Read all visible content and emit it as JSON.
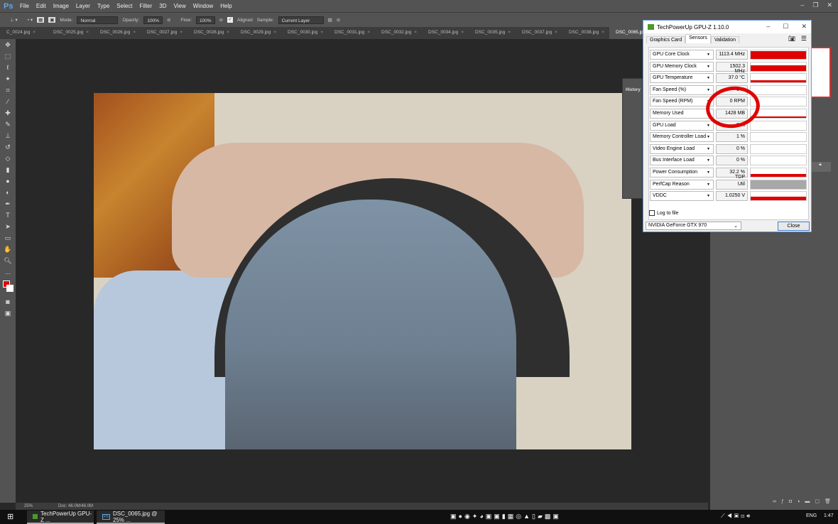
{
  "menubar": {
    "logo": "Ps",
    "items": [
      "File",
      "Edit",
      "Image",
      "Layer",
      "Type",
      "Select",
      "Filter",
      "3D",
      "View",
      "Window",
      "Help"
    ]
  },
  "options": {
    "mode_label": "Mode:",
    "mode": "Normal",
    "opacity_label": "Opacity:",
    "opacity": "100%",
    "flow_label": "Flow:",
    "flow": "100%",
    "aligned_label": "Aligned",
    "aligned": true,
    "sample_label": "Sample:",
    "sample": "Current Layer"
  },
  "tabs": [
    "C_0024.jpg",
    "DSC_0025.jpg",
    "DSC_0026.jpg",
    "DSC_0027.jpg",
    "DSC_0028.jpg",
    "DSC_0029.jpg",
    "DSC_0030.jpg",
    "DSC_0031.jpg",
    "DSC_0032.jpg",
    "DSC_0034.jpg",
    "DSC_0035.jpg",
    "DSC_0037.jpg",
    "DSC_0038.jpg",
    "DSC_0065.jpg"
  ],
  "active_tab": 13,
  "history": {
    "title": "History"
  },
  "status": {
    "zoom": "25%",
    "doc": "Doc: 46.0M/46.0M"
  },
  "gpuz": {
    "title": "TechPowerUp GPU-Z 1.10.0",
    "tabs": [
      "Graphics Card",
      "Sensors",
      "Validation"
    ],
    "active_tab": 1,
    "sensors": [
      {
        "label": "GPU Core Clock",
        "value": "1113.4 MHz",
        "graph": 0.9
      },
      {
        "label": "GPU Memory Clock",
        "value": "1502.3 MHz",
        "graph": 0.6
      },
      {
        "label": "GPU Temperature",
        "value": "37.0 °C",
        "graph": 0.25
      },
      {
        "label": "Fan Speed (%)",
        "value": "0 %",
        "graph": 0
      },
      {
        "label": "Fan Speed (RPM)",
        "value": "0 RPM",
        "graph": 0
      },
      {
        "label": "Memory Used",
        "value": "1428 MB",
        "graph": 0.2
      },
      {
        "label": "GPU Load",
        "value": "0 %",
        "graph": 0
      },
      {
        "label": "Memory Controller Load",
        "value": "1 %",
        "graph": 0
      },
      {
        "label": "Video Engine Load",
        "value": "0 %",
        "graph": 0
      },
      {
        "label": "Bus Interface Load",
        "value": "0 %",
        "graph": 0
      },
      {
        "label": "Power Consumption",
        "value": "32.2 % TDP",
        "graph": 0.3
      },
      {
        "label": "PerfCap Reason",
        "value": "Util",
        "graph": 1,
        "graph_color": "#a8a8a8"
      },
      {
        "label": "VDDC",
        "value": "1.0250 V",
        "graph": 0.4
      }
    ],
    "log_label": "Log to file",
    "log_checked": false,
    "gpu_select": "NVIDIA GeForce GTX 970",
    "close_label": "Close",
    "accent": "#e00000"
  },
  "taskbar": {
    "items": [
      "TechPowerUp GPU-Z ...",
      "DSC_0065.jpg @ 25% ..."
    ],
    "lang": "ENG",
    "time": "1:47"
  }
}
